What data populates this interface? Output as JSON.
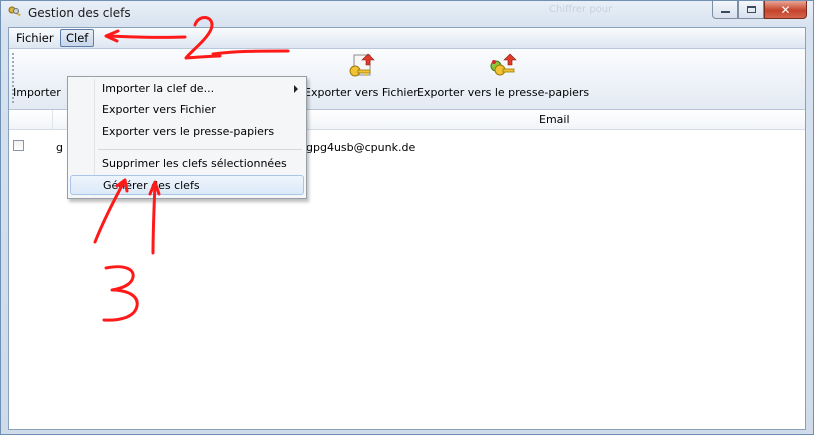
{
  "window": {
    "title": "Gestion des clefs",
    "ghost_text": "Chiffrer pour"
  },
  "menubar": {
    "file": "Fichier",
    "key": "Clef"
  },
  "toolbar": {
    "import_label": "Importer",
    "export_file_label": "Exporter vers Fichier",
    "export_clipboard_label": "Exporter vers le presse-papiers"
  },
  "list": {
    "header_email": "Email",
    "rows": [
      {
        "name": "g",
        "email": "gpg4usb@cpunk.de",
        "checked": false
      }
    ]
  },
  "dropdown": {
    "items": [
      {
        "label": "Importer la clef de...",
        "has_submenu": true
      },
      {
        "label": "Exporter vers Fichier"
      },
      {
        "label": "Exporter vers le presse-papiers"
      },
      {
        "label": "Supprimer les clefs sélectionnées"
      },
      {
        "label": "Générer des clefs",
        "highlighted": true
      }
    ]
  },
  "annotations": {
    "step2": "2",
    "step3": "3",
    "color": "#ff1a1a"
  },
  "icons": {
    "app": "keys-icon",
    "import": "key-import-icon",
    "export_file": "key-export-file-icon",
    "export_clipboard": "key-export-clipboard-icon"
  }
}
